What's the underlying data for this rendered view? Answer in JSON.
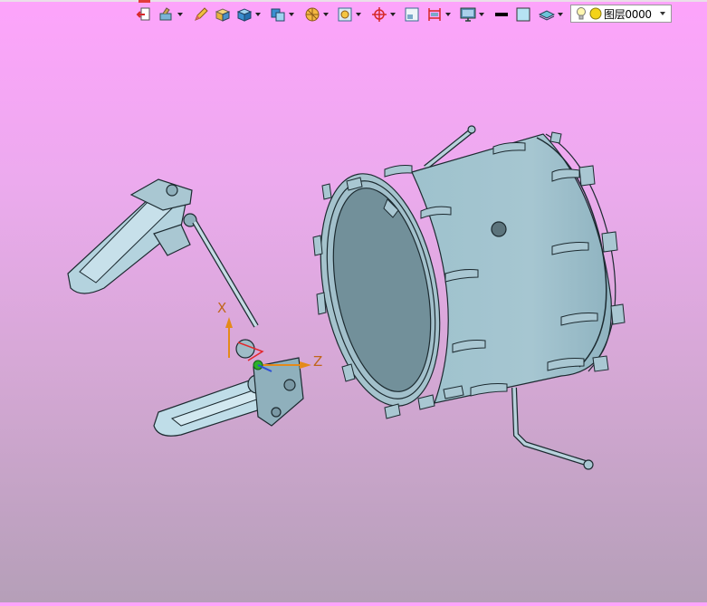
{
  "toolbar": {
    "layer_selector": {
      "value": "图层0000"
    },
    "colors": {
      "accent_orange": "#e48a1a",
      "model_fill": "#a9c7d2",
      "model_stroke": "#1c2a30"
    }
  },
  "viewport": {
    "triad": {
      "x_label": "X",
      "z_label": "Z"
    }
  }
}
